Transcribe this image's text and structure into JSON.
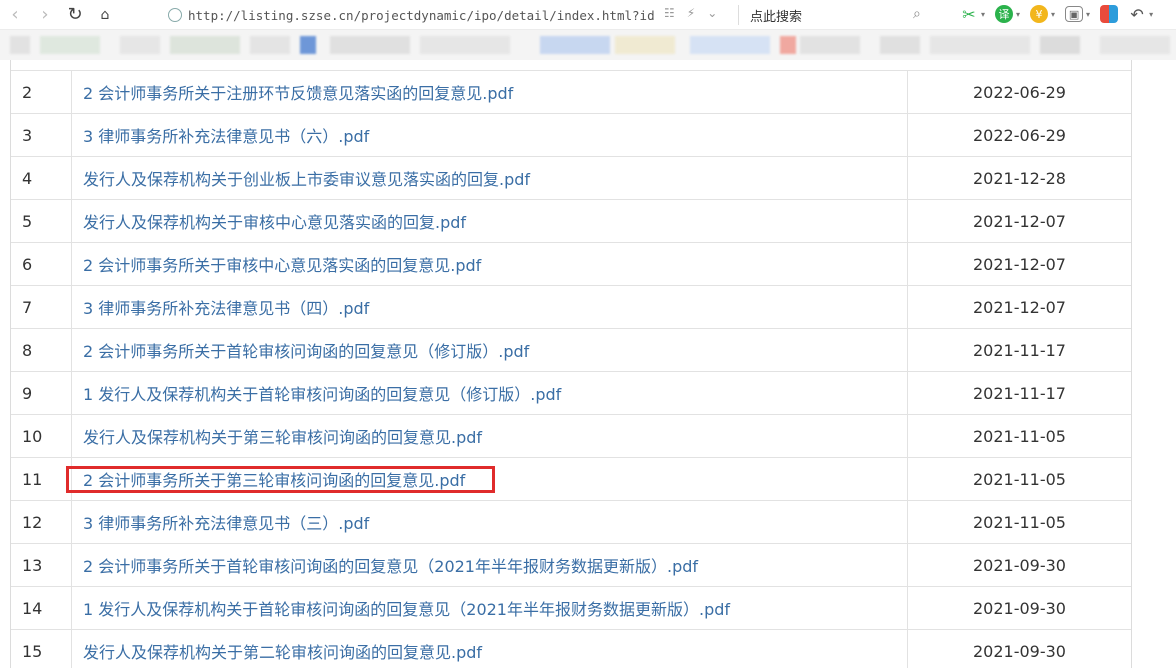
{
  "browser": {
    "url": "http://listing.szse.cn/projectdynamic/ipo/detail/index.html?id",
    "search_placeholder": "点此搜索"
  },
  "table": {
    "rows": [
      {
        "num": "2",
        "title": "2 会计师事务所关于注册环节反馈意见落实函的回复意见.pdf",
        "date": "2022-06-29"
      },
      {
        "num": "3",
        "title": "3 律师事务所补充法律意见书（六）.pdf",
        "date": "2022-06-29"
      },
      {
        "num": "4",
        "title": "发行人及保荐机构关于创业板上市委审议意见落实函的回复.pdf",
        "date": "2021-12-28"
      },
      {
        "num": "5",
        "title": "发行人及保荐机构关于审核中心意见落实函的回复.pdf",
        "date": "2021-12-07"
      },
      {
        "num": "6",
        "title": "2 会计师事务所关于审核中心意见落实函的回复意见.pdf",
        "date": "2021-12-07"
      },
      {
        "num": "7",
        "title": "3 律师事务所补充法律意见书（四）.pdf",
        "date": "2021-12-07"
      },
      {
        "num": "8",
        "title": "2 会计师事务所关于首轮审核问询函的回复意见（修订版）.pdf",
        "date": "2021-11-17"
      },
      {
        "num": "9",
        "title": "1 发行人及保荐机构关于首轮审核问询函的回复意见（修订版）.pdf",
        "date": "2021-11-17"
      },
      {
        "num": "10",
        "title": "发行人及保荐机构关于第三轮审核问询函的回复意见.pdf",
        "date": "2021-11-05"
      },
      {
        "num": "11",
        "title": "2 会计师事务所关于第三轮审核问询函的回复意见.pdf",
        "date": "2021-11-05"
      },
      {
        "num": "12",
        "title": "3 律师事务所补充法律意见书（三）.pdf",
        "date": "2021-11-05"
      },
      {
        "num": "13",
        "title": "2 会计师事务所关于首轮审核问询函的回复意见（2021年半年报财务数据更新版）.pdf",
        "date": "2021-09-30"
      },
      {
        "num": "14",
        "title": "1 发行人及保荐机构关于首轮审核问询函的回复意见（2021年半年报财务数据更新版）.pdf",
        "date": "2021-09-30"
      },
      {
        "num": "15",
        "title": "发行人及保荐机构关于第二轮审核问询函的回复意见.pdf",
        "date": "2021-09-30"
      }
    ]
  },
  "colors": {
    "link": "#3a6ea5",
    "highlight": "#e02b2b"
  }
}
